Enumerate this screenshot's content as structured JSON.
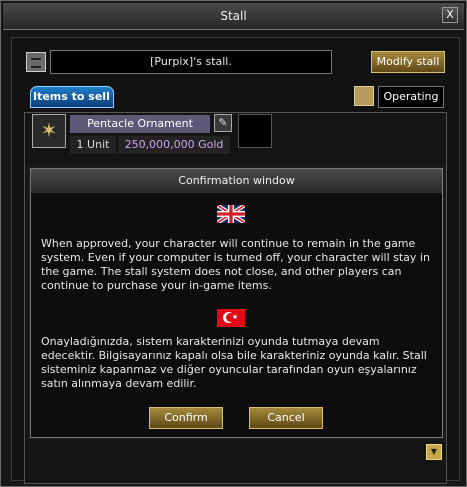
{
  "window": {
    "title": "Stall",
    "close_glyph": "X"
  },
  "stall": {
    "name": "[Purpix]'s stall.",
    "modify_label": "Modify stall",
    "tab_label": "Items to sell",
    "status_label": "Operating"
  },
  "item": {
    "icon": "pentacle-ornament-icon",
    "name": "Pentacle Ornament",
    "units": "1 Unit",
    "price": "250,000,000 Gold",
    "price_color": "#c8a8f0"
  },
  "dialog": {
    "title": "Confirmation window",
    "text_en": "When approved, your character will continue to remain in the game system. Even if your computer is turned off, your character will stay in the game. The stall system does not close, and other players can continue to purchase your in-game items.",
    "text_tr": "Onayladığınızda, sistem karakterinizi oyunda tutmaya devam edecektir. Bilgisayarınız kapalı olsa bile karakteriniz oyunda kalır. Stall sisteminiz kapanmaz ve diğer oyuncular tarafından oyun eşyalarınız satın alınmaya devam edilir.",
    "confirm_label": "Confirm",
    "cancel_label": "Cancel"
  },
  "colors": {
    "button_gold": "#a58a3c",
    "tab_blue": "#1e7ec8",
    "flag_red": "#e30a17"
  }
}
